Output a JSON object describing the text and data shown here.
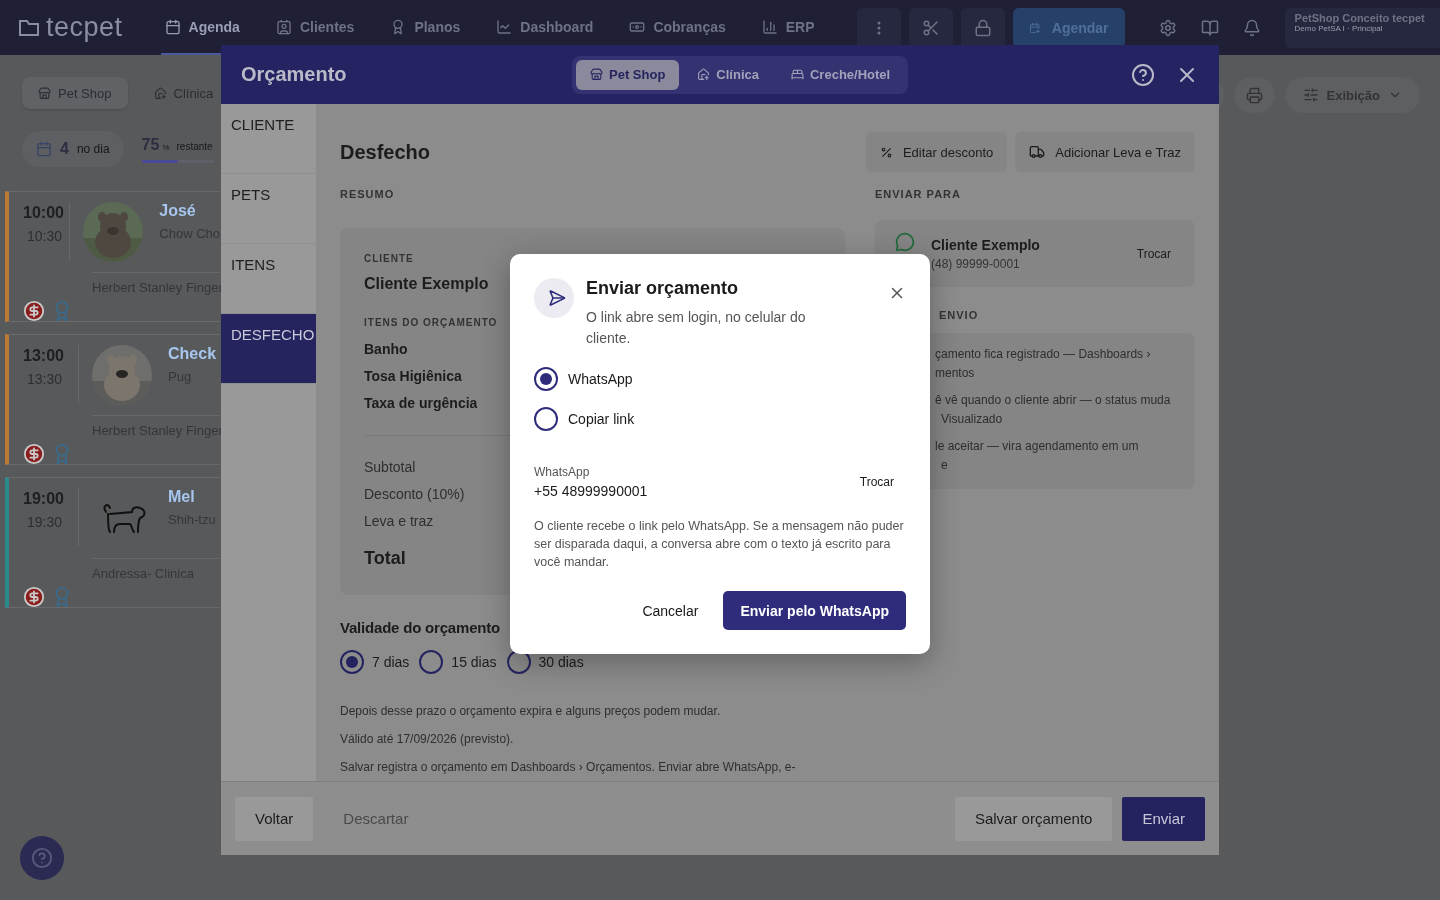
{
  "topbar": {
    "logo": "tecpet",
    "nav": [
      {
        "label": "Agenda",
        "selected": true
      },
      {
        "label": "Clientes",
        "selected": false
      },
      {
        "label": "Planos",
        "selected": false
      },
      {
        "label": "Dashboard",
        "selected": false
      },
      {
        "label": "Cobranças",
        "selected": false
      },
      {
        "label": "ERP",
        "selected": false
      }
    ],
    "schedule_button": "Agendar",
    "account": {
      "name": "PetShop Conceito tecpet",
      "subtitle": "Demo PetSA I · Principal"
    }
  },
  "left_panel": {
    "modes": [
      {
        "label": "Pet Shop",
        "selected": true
      },
      {
        "label": "Clínica",
        "selected": false
      }
    ],
    "day_count": {
      "value": "4",
      "label": "no dia"
    },
    "remaining": {
      "value": "75",
      "unit": "%",
      "label": "restante",
      "level": 0.5
    },
    "appointments": [
      {
        "start": "10:00",
        "end": "10:30",
        "name": "José",
        "breed": "Chow Cho",
        "owner": "Herbert Stanley Finger",
        "color": "#b97a35",
        "kind": "picture"
      },
      {
        "start": "13:00",
        "end": "13:30",
        "name": "Check",
        "breed": "Pug",
        "owner": "Herbert Stanley Finger",
        "color": "#b97a35",
        "kind": "picture"
      },
      {
        "start": "19:00",
        "end": "19:30",
        "name": "Mel",
        "breed": "Shih-tzu",
        "owner": "Andressa- Clinica",
        "color": "#2a8a8c",
        "kind": "drawing"
      }
    ]
  },
  "toolbar": {
    "view_label": "Exibição"
  },
  "drawer": {
    "title": "Orçamento",
    "tabs": [
      {
        "label": "Pet Shop",
        "selected": true
      },
      {
        "label": "Clínica",
        "selected": false
      },
      {
        "label": "Creche/Hotel",
        "selected": false
      }
    ],
    "steps": [
      {
        "label": "CLIENTE",
        "selected": false
      },
      {
        "label": "PETS",
        "selected": false
      },
      {
        "label": "ITENS",
        "selected": false
      },
      {
        "label": "DESFECHO",
        "selected": true
      }
    ],
    "heading": "Desfecho",
    "actions": [
      "Editar desconto",
      "Adicionar Leva e Traz"
    ],
    "summary": {
      "section": "RESUMO",
      "client_label": "CLIENTE",
      "client_name": "Cliente Exemplo",
      "items_label": "ITENS DO ORÇAMENTO",
      "items": [
        "Banho",
        "Tosa Higiênica",
        "Taxa de urgência"
      ],
      "totals": [
        "Subtotal",
        "Desconto (10%)",
        "Leva e traz"
      ],
      "total_label": "Total"
    },
    "validity": {
      "title": "Validade do orçamento",
      "options": [
        {
          "label": "7 dias",
          "selected": true
        },
        {
          "label": "15 dias",
          "selected": false
        },
        {
          "label": "30 dias",
          "selected": false
        }
      ],
      "notes": [
        "Depois desse prazo o orçamento expira e alguns preços podem mudar.",
        "Válido até 17/09/2026 (previsto).",
        "Salvar registra o orçamento em Dashboards › Orçamentos. Enviar abre WhatsApp, e-"
      ]
    },
    "send_to": {
      "section": "ENVIAR PARA",
      "name": "Cliente Exemplo",
      "phone": "(48) 99999-0001",
      "change": "Trocar"
    },
    "sending": {
      "section": "ENVIO",
      "items": [
        [
          "çamento fica registrado — Dashboards ›",
          "mentos"
        ],
        [
          "ê vê quando o cliente abrir — o status muda",
          "Visualizado"
        ],
        [
          "le aceitar — vira agendamento em um",
          "e"
        ]
      ]
    },
    "footer": {
      "back": "Voltar",
      "discard": "Descartar",
      "save": "Salvar orçamento",
      "send": "Enviar"
    }
  },
  "modal": {
    "title": "Enviar orçamento",
    "subtitle": "O link abre sem login, no celular do cliente.",
    "options": [
      {
        "label": "WhatsApp",
        "selected": true
      },
      {
        "label": "Copiar link",
        "selected": false
      }
    ],
    "contact_label": "WhatsApp",
    "contact_value": "+55 48999990001",
    "change": "Trocar",
    "note": "O cliente recebe o link pelo WhatsApp. Se a mensagem não puder ser disparada daqui, a conversa abre com o texto já escrito para você mandar.",
    "cancel": "Cancelar",
    "confirm": "Enviar pelo WhatsApp"
  }
}
